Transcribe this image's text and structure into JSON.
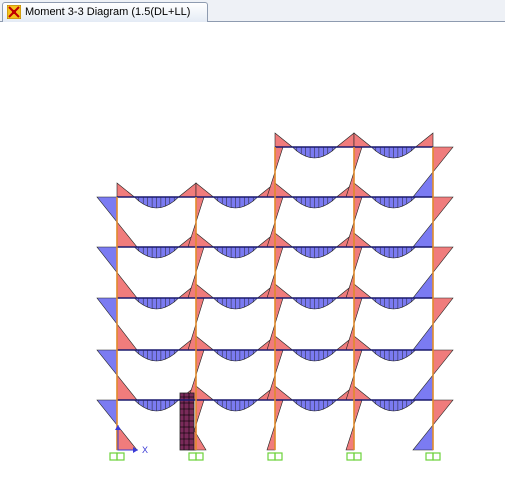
{
  "window": {
    "tab_title": "Moment 3-3 Diagram (1.5(DL+LL)",
    "tab_icon": "structure-app-icon"
  },
  "viewport": {
    "axis_label_x": "X",
    "colors": {
      "background": "#ffffff",
      "positive_moment": "#7b7bf2",
      "negative_moment": "#f07c7c",
      "beam_line": "#1a1a6e",
      "column_line": "#e08a2c",
      "support": "#6cd13a",
      "shear_wall": "#7a2a5a"
    }
  }
}
